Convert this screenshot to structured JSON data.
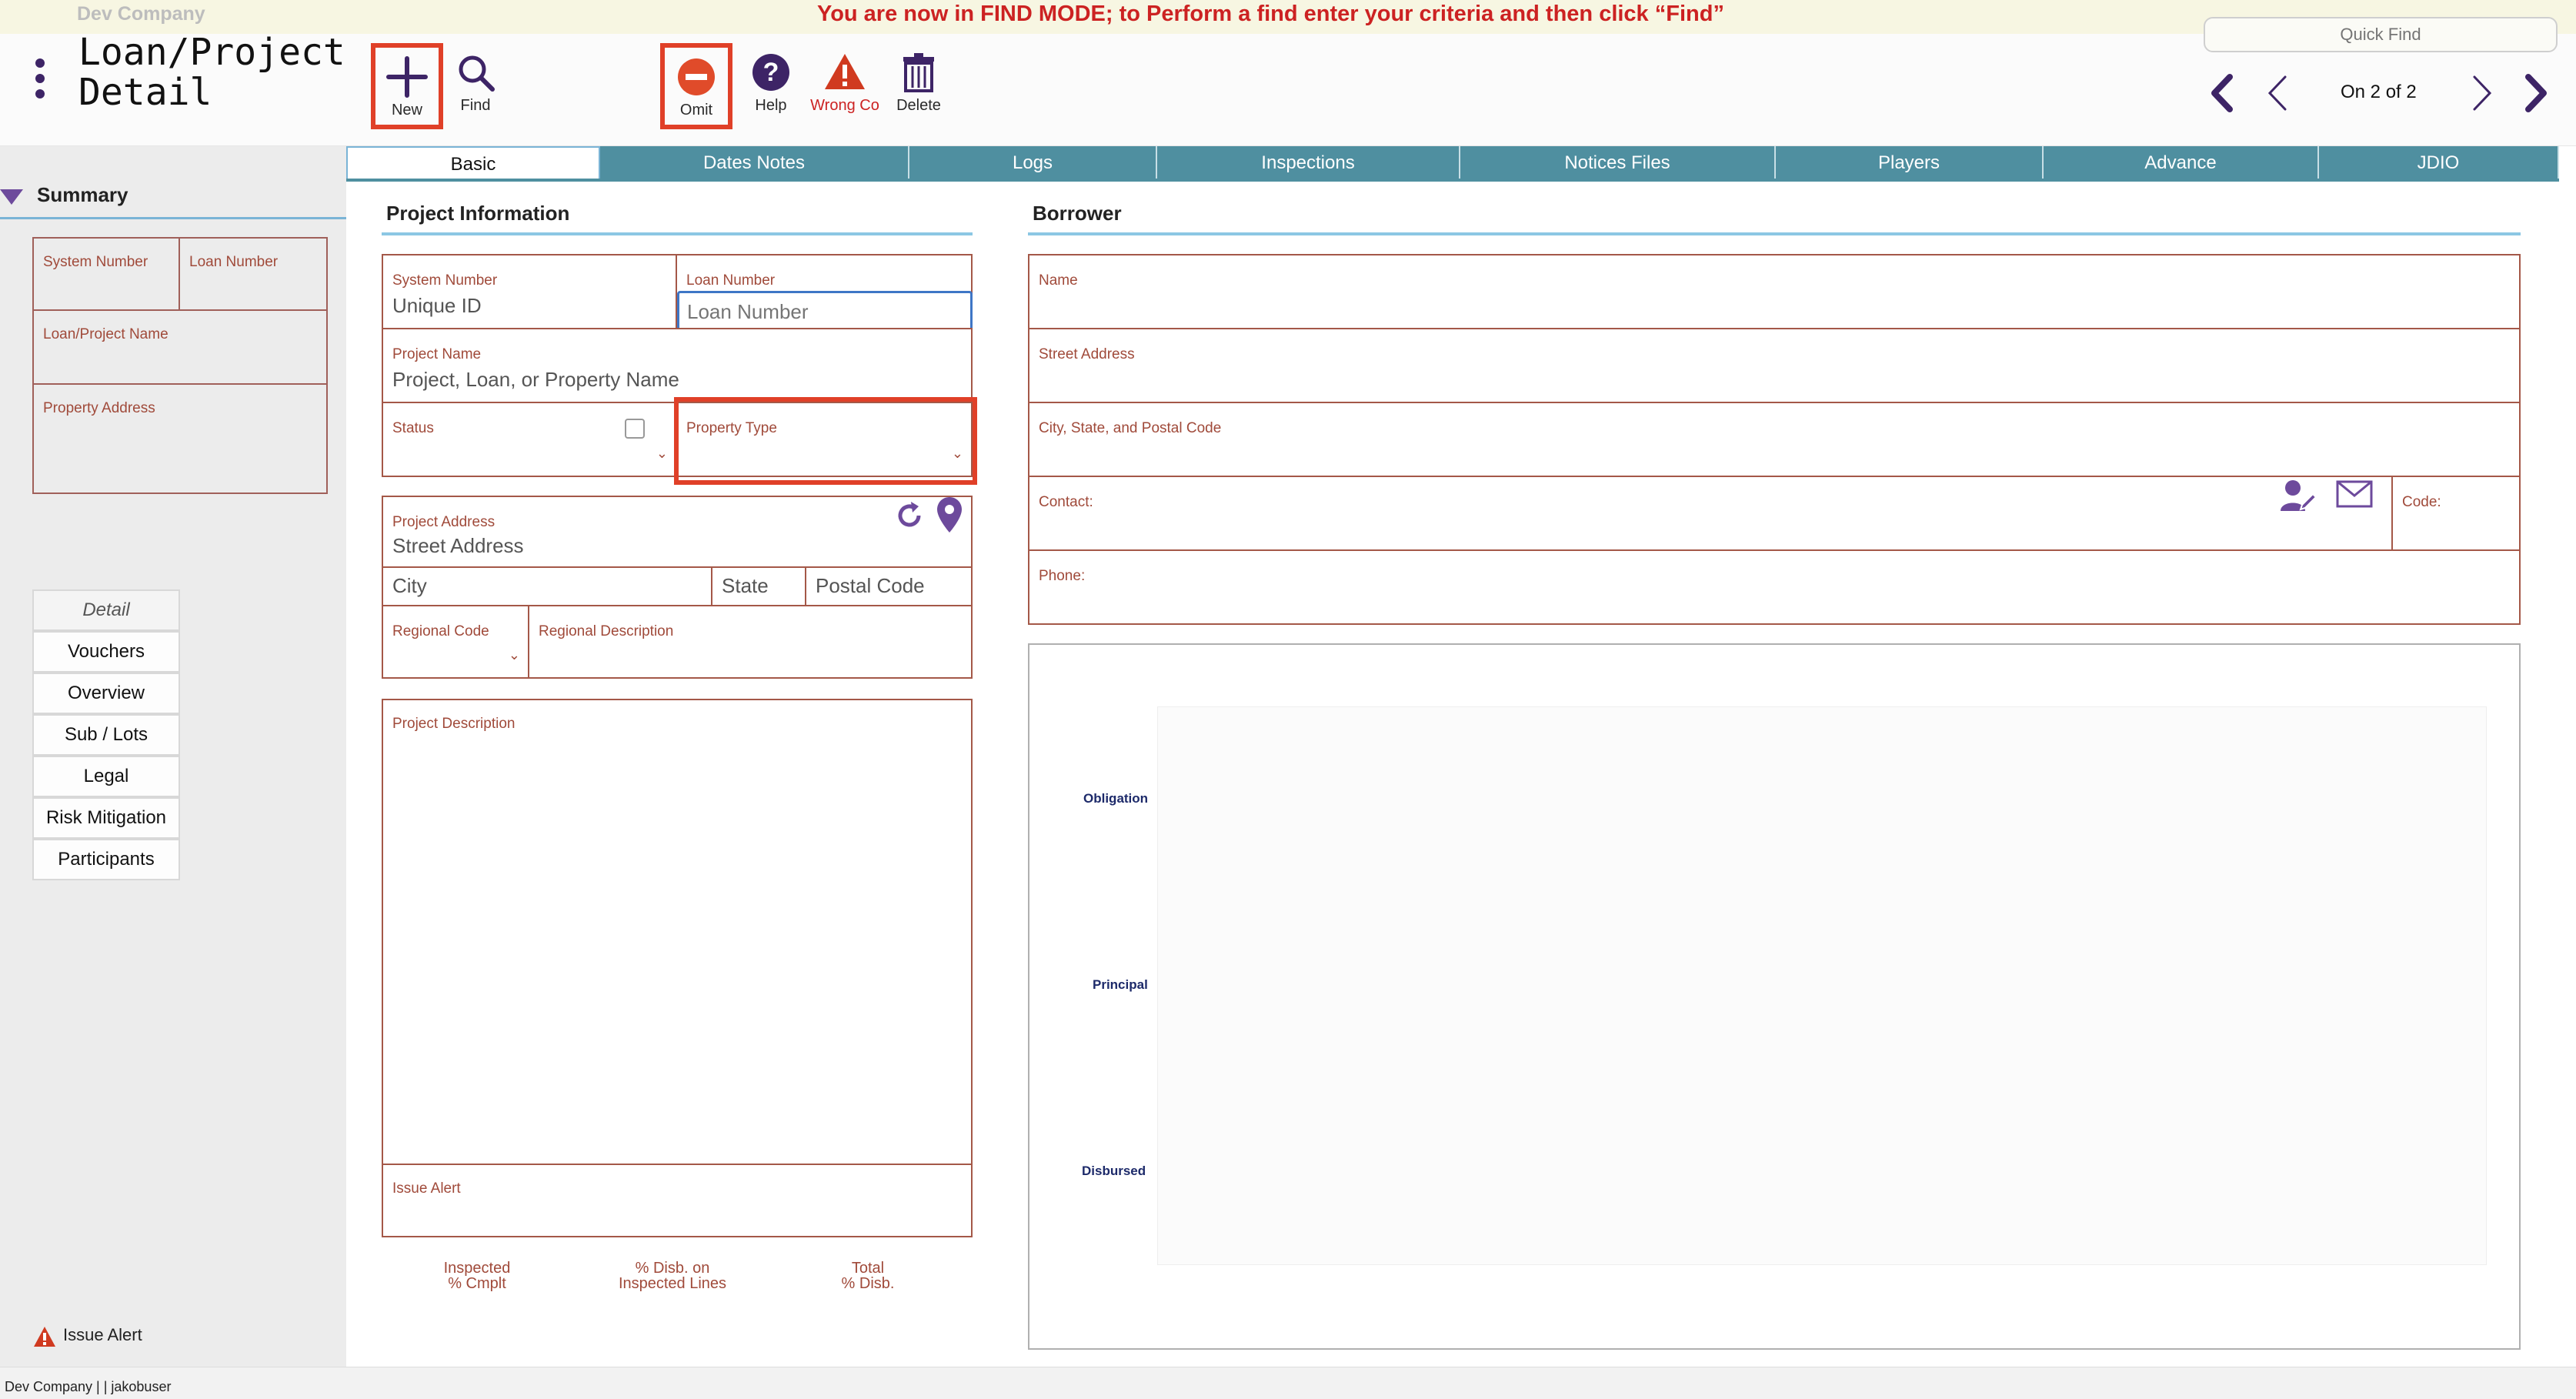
{
  "banner": {
    "company": "Dev Company",
    "message": "You are now in FIND MODE; to Perform a find enter your criteria and then click “Find”",
    "quick_find_placeholder": "Quick Find"
  },
  "header": {
    "title": "Loan/Project\nDetail",
    "toolbar": {
      "new": "New",
      "find": "Find",
      "omit": "Omit",
      "help": "Help",
      "wrong_co": "Wrong Co",
      "delete": "Delete"
    },
    "record_nav": "On 2 of 2"
  },
  "sidebar": {
    "summary_label": "Summary",
    "summary_fields": {
      "system_number": "System Number",
      "loan_number": "Loan Number",
      "loan_project_name": "Loan/Project Name",
      "property_address": "Property Address"
    },
    "detail_buttons": [
      "Detail",
      "Vouchers",
      "Overview",
      "Sub / Lots",
      "Legal",
      "Risk Mitigation",
      "Participants"
    ],
    "issue_alert": "Issue Alert"
  },
  "tabs": [
    "Basic",
    "Dates Notes",
    "Logs",
    "Inspections",
    "Notices Files",
    "Players",
    "Advance",
    "JDIO"
  ],
  "project_info": {
    "heading": "Project Information",
    "system_number_label": "System Number",
    "system_number_value": "Unique ID",
    "loan_number_label": "Loan Number",
    "loan_number_placeholder": "Loan Number",
    "project_name_label": "Project Name",
    "project_name_value": "Project, Loan, or Property Name",
    "status_label": "Status",
    "property_type_label": "Property Type",
    "project_address_label": "Project Address",
    "street_placeholder": "Street Address",
    "city_placeholder": "City",
    "state_placeholder": "State",
    "postal_placeholder": "Postal Code",
    "regional_code_label": "Regional Code",
    "regional_desc_label": "Regional Description",
    "project_description_label": "Project Description",
    "issue_alert_label": "Issue Alert",
    "stats": [
      {
        "line1": "Inspected",
        "line2": "% Cmplt"
      },
      {
        "line1": "% Disb. on",
        "line2": "Inspected Lines"
      },
      {
        "line1": "Total",
        "line2": "% Disb."
      }
    ]
  },
  "borrower": {
    "heading": "Borrower",
    "name_label": "Name",
    "street_label": "Street Address",
    "city_label": "City, State, and Postal Code",
    "contact_label": "Contact:",
    "code_label": "Code:",
    "phone_label": "Phone:",
    "chart_labels": [
      "Obligation",
      "Principal",
      "Disbursed"
    ]
  },
  "footer": {
    "text": "Dev Company |  | jakobuser"
  },
  "colors": {
    "tab_bg": "#4f8fa0",
    "label_brown": "#a04a3a",
    "highlight_red": "#e04028",
    "brand_purple": "#3d2466",
    "warning_red": "#cc2222"
  }
}
